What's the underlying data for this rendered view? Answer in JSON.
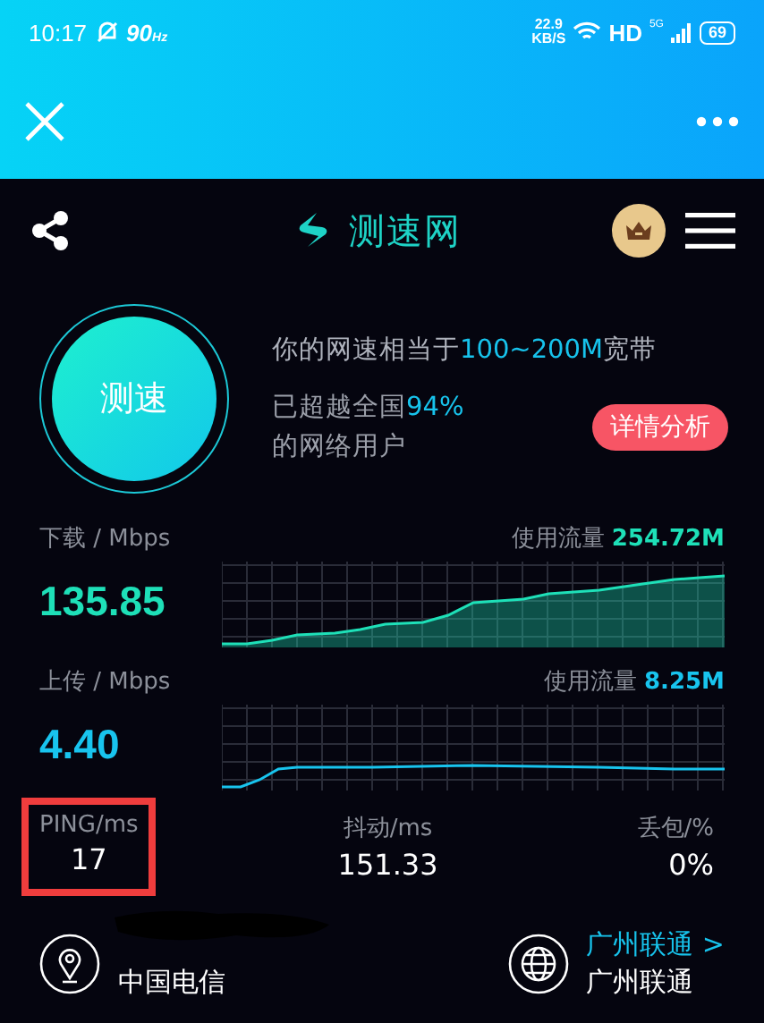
{
  "status_bar": {
    "time": "10:17",
    "refresh_rate": "90",
    "refresh_unit": "Hz",
    "net_speed": "22.9",
    "net_unit": "KB/S",
    "hd": "HD",
    "network": "5G",
    "battery": "69"
  },
  "app_bar": {
    "logo_text": "测速网"
  },
  "speed_test": {
    "button": "测速",
    "summary_prefix": "你的网速相当于",
    "summary_range": "100~200M",
    "summary_suffix": "宽带",
    "rank_prefix": "已超越全国",
    "rank_value": "94%",
    "rank_suffix": "的网络用户",
    "detail_button": "详情分析"
  },
  "metrics": [
    {
      "kind": "download",
      "label": "下载 / Mbps",
      "value": "135.85",
      "usage_label": "使用流量",
      "usage": "254.72M"
    },
    {
      "kind": "upload",
      "label": "上传 / Mbps",
      "value": "4.40",
      "usage_label": "使用流量",
      "usage": "8.25M"
    }
  ],
  "stats": [
    {
      "label": "PING/ms",
      "value": "17",
      "highlighted": true
    },
    {
      "label": "抖动/ms",
      "value": "151.33",
      "highlighted": false
    },
    {
      "label": "丢包/%",
      "value": "0%",
      "highlighted": false
    }
  ],
  "footer": {
    "operator": "中国电信",
    "server_link": "广州联通 >",
    "server": "广州联通"
  }
}
